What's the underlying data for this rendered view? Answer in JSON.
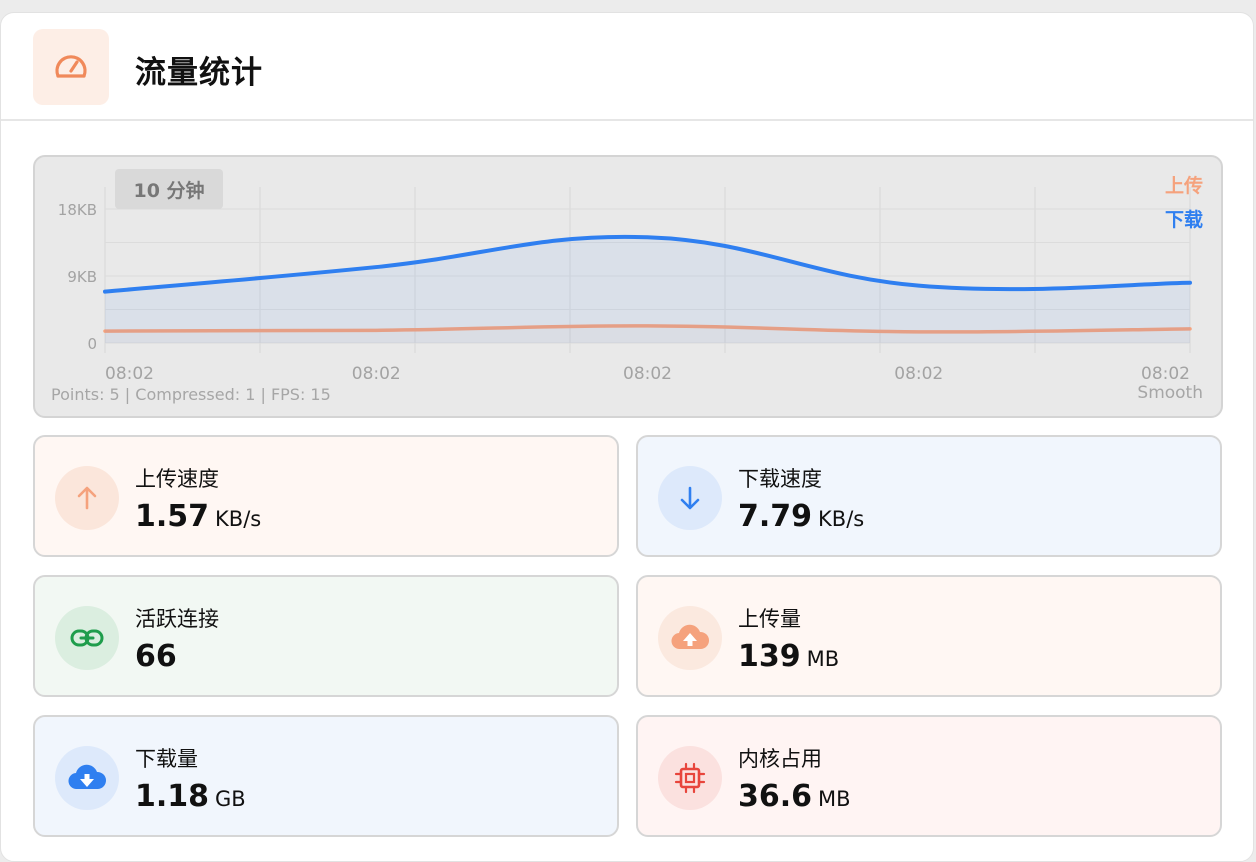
{
  "header": {
    "title": "流量统计",
    "icon": "speedometer-icon"
  },
  "chart_data": {
    "type": "area",
    "range_label": "10 分钟",
    "ylabels": [
      "18KB",
      "9KB",
      "0"
    ],
    "xlabels": [
      "08:02",
      "08:02",
      "08:02",
      "08:02",
      "08:02"
    ],
    "y_unit": "KB",
    "ylim": [
      0,
      18
    ],
    "x": [
      0,
      1,
      2,
      3,
      4
    ],
    "series": [
      {
        "name": "上传",
        "color": "#f5a27d",
        "values": [
          1.6,
          1.7,
          2.3,
          1.5,
          1.9
        ]
      },
      {
        "name": "下载",
        "color": "#2f7ff0",
        "values": [
          6.9,
          10.2,
          14.2,
          7.7,
          8.1
        ]
      }
    ],
    "grid": true,
    "legend": "top-right",
    "stats_text": "Points: 5 | Compressed: 1 | FPS: 15",
    "mode_label": "Smooth"
  },
  "stats": [
    {
      "label": "上传速度",
      "value": "1.57",
      "unit": "KB/s",
      "icon": "arrow-up-icon"
    },
    {
      "label": "下载速度",
      "value": "7.79",
      "unit": "KB/s",
      "icon": "arrow-down-icon"
    },
    {
      "label": "活跃连接",
      "value": "66",
      "unit": "",
      "icon": "link-icon"
    },
    {
      "label": "上传量",
      "value": "139",
      "unit": "MB",
      "icon": "cloud-upload-icon"
    },
    {
      "label": "下载量",
      "value": "1.18",
      "unit": "GB",
      "icon": "cloud-download-icon"
    },
    {
      "label": "内核占用",
      "value": "36.6",
      "unit": "MB",
      "icon": "cpu-chip-icon"
    }
  ],
  "colors": {
    "upload": "#f5a27d",
    "download": "#2f7ff0",
    "connections": "#1f9d4c",
    "memory": "#e8453c"
  }
}
